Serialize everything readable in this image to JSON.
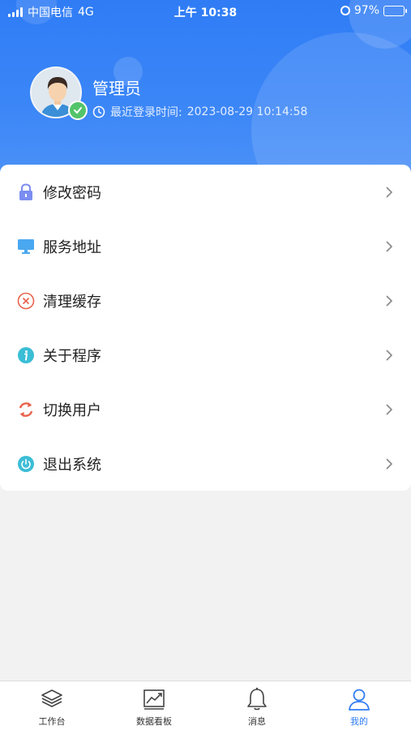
{
  "status_bar": {
    "carrier": "中国电信",
    "network": "4G",
    "time": "上午 10:38",
    "battery": "97%"
  },
  "profile": {
    "name": "管理员",
    "last_login_label": "最近登录时间:",
    "last_login_time": "2023-08-29 10:14:58"
  },
  "menu": {
    "items": [
      {
        "label": "修改密码",
        "icon": "lock-icon",
        "color": "#7b8df0"
      },
      {
        "label": "服务地址",
        "icon": "monitor-icon",
        "color": "#4aa8f0"
      },
      {
        "label": "清理缓存",
        "icon": "clear-icon",
        "color": "#e8624c"
      },
      {
        "label": "关于程序",
        "icon": "info-icon",
        "color": "#3bbdd6"
      },
      {
        "label": "切换用户",
        "icon": "switch-icon",
        "color": "#e8624c"
      },
      {
        "label": "退出系统",
        "icon": "power-icon",
        "color": "#3bbdd6"
      }
    ]
  },
  "tabbar": {
    "tabs": [
      {
        "label": "工作台",
        "icon": "layers-icon"
      },
      {
        "label": "数据看板",
        "icon": "chart-icon"
      },
      {
        "label": "消息",
        "icon": "bell-icon"
      },
      {
        "label": "我的",
        "icon": "user-icon",
        "active": true
      }
    ]
  },
  "colors": {
    "header_blue": "#2f7cf5",
    "accent": "#2f7cf5",
    "verified_green": "#53c46a"
  }
}
